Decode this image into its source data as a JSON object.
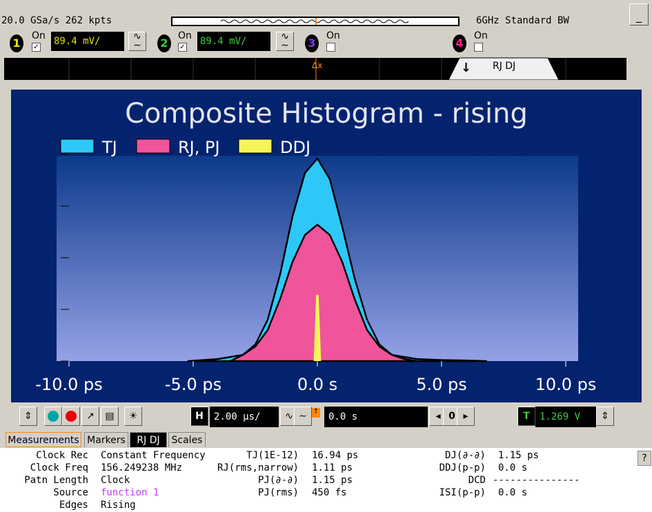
{
  "topbar": {
    "acquisition": "20.0 GSa/s   262 kpts",
    "bandwidth": "6GHz Standard BW",
    "minimize": "_"
  },
  "channels": [
    {
      "num": "1",
      "on_label": "On",
      "checked": true,
      "scale": "89.4 mV/",
      "color": "#f2e600",
      "scale_color": "#e0e000"
    },
    {
      "num": "2",
      "on_label": "On",
      "checked": true,
      "scale": "89.4 mV/",
      "color": "#3ec83e",
      "scale_color": "#3ec83e"
    },
    {
      "num": "3",
      "on_label": "On",
      "checked": false,
      "color": "#7a3cf0"
    },
    {
      "num": "4",
      "on_label": "On",
      "checked": false,
      "color": "#ff2090"
    }
  ],
  "trackbar": {
    "marker": "Δx"
  },
  "rj_tab": {
    "arrow": "↓",
    "label": "RJ DJ"
  },
  "chart_data": {
    "type": "area",
    "title": "Composite Histogram - rising",
    "legend": [
      "TJ",
      "RJ, PJ",
      "DDJ"
    ],
    "legend_placement": "top-left",
    "x_tick_labels": [
      "-10.0 ps",
      "-5.0 ps",
      "0.0 s",
      "5.0 ps",
      "10.0 ps"
    ],
    "xlim_ps": [
      -10,
      10
    ],
    "ylim": [
      0,
      1
    ],
    "series": [
      {
        "name": "TJ",
        "color": "#2ec8f8",
        "x_ps": [
          -5.2,
          -4,
          -3,
          -2.5,
          -2,
          -1.5,
          -1,
          -0.5,
          0,
          0.5,
          1,
          1.5,
          2,
          2.5,
          3,
          4,
          5,
          6,
          6.8
        ],
        "y": [
          0,
          0.01,
          0.03,
          0.08,
          0.2,
          0.42,
          0.7,
          0.91,
          0.98,
          0.88,
          0.65,
          0.4,
          0.2,
          0.08,
          0.03,
          0.01,
          0.005,
          0.003,
          0
        ]
      },
      {
        "name": "RJ, PJ",
        "color": "#f0549a",
        "x_ps": [
          -3.5,
          -3,
          -2.5,
          -2,
          -1.5,
          -1,
          -0.5,
          0,
          0.5,
          1,
          1.5,
          2,
          2.5,
          3,
          3.5,
          4
        ],
        "y": [
          0,
          0.03,
          0.07,
          0.15,
          0.3,
          0.48,
          0.61,
          0.66,
          0.61,
          0.48,
          0.3,
          0.15,
          0.07,
          0.03,
          0.01,
          0
        ]
      },
      {
        "name": "DDJ",
        "color": "#f5f55a",
        "x_ps": [
          -0.15,
          -0.05,
          0.05,
          0.15
        ],
        "y": [
          0,
          0.32,
          0.32,
          0
        ]
      }
    ]
  },
  "toolbar": {
    "h_label": "H",
    "horizontal_scale": "2.00 µs/",
    "delay": "0.0 s",
    "zero_label": "0",
    "t_label": "T",
    "trigger_level": "1.269 V"
  },
  "tabs": [
    "Measurements",
    "Markers",
    "RJ DJ",
    "Scales"
  ],
  "results": {
    "col1": [
      {
        "label": "Clock Rec",
        "value": "Constant Frequency"
      },
      {
        "label": "Clock Freq",
        "value": "156.249238 MHz"
      },
      {
        "label": "Patn Length",
        "value": "Clock"
      },
      {
        "label": "Source",
        "value": "function 1"
      },
      {
        "label": "Edges",
        "value": "Rising"
      }
    ],
    "col2": [
      {
        "label": "TJ(1E-12)",
        "value": "16.94 ps"
      },
      {
        "label": "RJ(rms,narrow)",
        "value": "1.11 ps"
      },
      {
        "label": "PJ(∂-∂)",
        "value": "1.15 ps"
      },
      {
        "label": "PJ(rms)",
        "value": "450 fs"
      }
    ],
    "col3": [
      {
        "label": "DJ(∂-∂)",
        "value": "1.15 ps"
      },
      {
        "label": "DDJ(p-p)",
        "value": "0.0 s"
      },
      {
        "label": "DCD",
        "value": "---------------"
      },
      {
        "label": "ISI(p-p)",
        "value": "0.0 s"
      }
    ],
    "help": "?"
  }
}
